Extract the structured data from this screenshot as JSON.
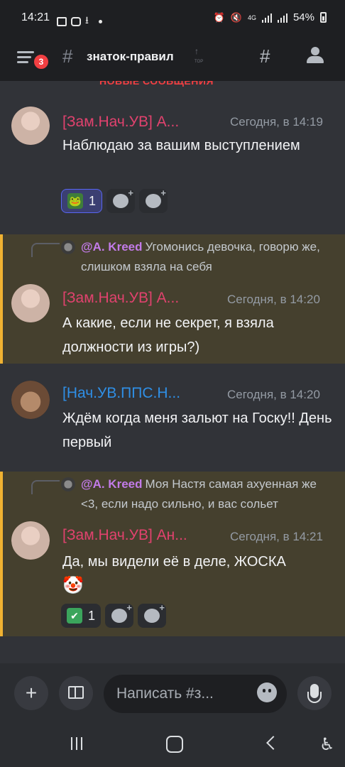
{
  "status_bar": {
    "time": "14:21",
    "network": "4G",
    "battery": "54%"
  },
  "header": {
    "badge_count": "3",
    "hash": "#",
    "channel_name": "знаток-правил",
    "top_label": "TOP"
  },
  "divider": {
    "label": "НОВЫЕ СООБЩЕНИЯ"
  },
  "messages": [
    {
      "author": "[Зам.Нач.УВ] А...",
      "author_color": "#e1426e",
      "timestamp": "Сегодня, в 14:19",
      "text": "Наблюдаю за вашим выступлением",
      "reactions": [
        {
          "emoji": "pepe",
          "count": "1",
          "active": true
        }
      ]
    },
    {
      "reply_author": "@A. Kreed",
      "reply_text": "Угомонись девочка, говорю же, слишком взяла на себя",
      "author": "[Зам.Нач.УВ] А...",
      "author_color": "#e1426e",
      "timestamp": "Сегодня, в 14:20",
      "text": "А какие, если не секрет, я взяла должности из игры?)",
      "mention": true
    },
    {
      "author": "[Нач.УВ.ППС.Н...",
      "author_color": "#2f8fe6",
      "timestamp": "Сегодня, в 14:20",
      "text": "Ждём когда меня зальют на Госку!! День первый"
    },
    {
      "reply_author": "@A. Kreed",
      "reply_text": "Моя Настя самая ахуенная же <3, если надо сильно, и вас сольет",
      "author": "[Зам.Нач.УВ] Ан...",
      "author_color": "#e1426e",
      "timestamp": "Сегодня, в 14:21",
      "text": "Да, мы видели её в деле, ЖОСКА",
      "emoji": "🤡",
      "mention": true,
      "reactions": [
        {
          "emoji": "✔",
          "count": "1",
          "active": false
        }
      ]
    }
  ],
  "composer": {
    "placeholder": "Написать #з...",
    "plus": "+"
  },
  "accent_color": "#5865f2",
  "mention_color": "#f0b232"
}
